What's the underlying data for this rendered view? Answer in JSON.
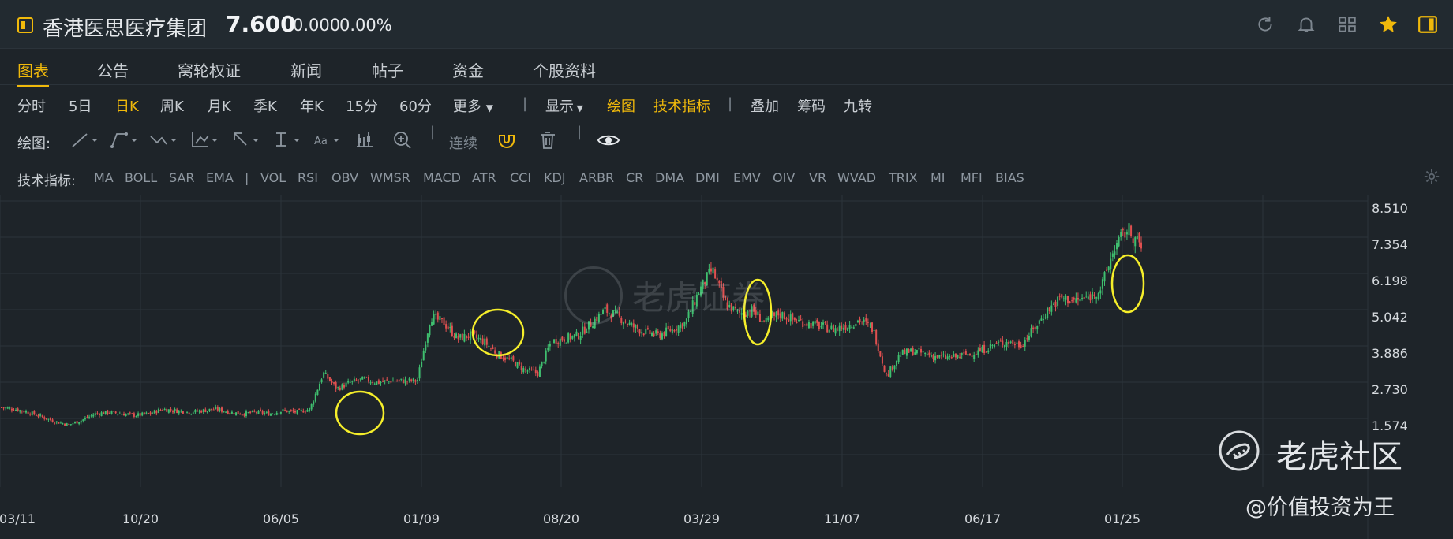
{
  "header": {
    "title": "香港医思医疗集团",
    "price": "7.600",
    "change": "0.000",
    "change_pct": "0.00%",
    "icons": [
      "refresh-icon",
      "bell-icon",
      "grid-icon",
      "star-icon",
      "panel-icon"
    ]
  },
  "tabs": [
    "图表",
    "公告",
    "窝轮权证",
    "新闻",
    "帖子",
    "资金",
    "个股资料"
  ],
  "active_tab": "图表",
  "periods": {
    "items": [
      "分时",
      "5日",
      "日K",
      "周K",
      "月K",
      "季K",
      "年K",
      "15分",
      "60分"
    ],
    "more": "更多",
    "display": "显示",
    "draw": "绘图",
    "tech": "技术指标",
    "overlay": "叠加",
    "chips": "筹码",
    "nine": "九转",
    "active": "日K"
  },
  "draw_row": {
    "label": "绘图:",
    "continuous": "连续"
  },
  "indicator_row": {
    "label": "技术指标:",
    "main": [
      "MA",
      "BOLL",
      "SAR",
      "EMA"
    ],
    "sub": [
      "VOL",
      "RSI",
      "OBV",
      "WMSR",
      "MACD",
      "ATR",
      "CCI",
      "KDJ",
      "ARBR",
      "CR",
      "DMA",
      "DMI",
      "EMV",
      "OIV",
      "VR",
      "WVAD",
      "TRIX",
      "MI",
      "MFI",
      "BIAS"
    ]
  },
  "watermark": {
    "center": "老虎证券",
    "corner": "老虎社区",
    "author": "@价值投资为王"
  },
  "chart_data": {
    "type": "candlestick",
    "y_ticks": [
      "8.510",
      "7.354",
      "6.198",
      "5.042",
      "3.886",
      "2.730",
      "1.574"
    ],
    "x_ticks": [
      "03/11",
      "10/20",
      "06/05",
      "01/09",
      "08/20",
      "03/29",
      "11/07",
      "06/17",
      "01/25"
    ],
    "ylim": [
      1.574,
      8.51
    ],
    "close_series": [
      2.5,
      2.45,
      2.35,
      2.2,
      2.05,
      1.95,
      2.1,
      2.3,
      2.35,
      2.3,
      2.25,
      2.3,
      2.45,
      2.4,
      2.35,
      2.4,
      2.45,
      2.35,
      2.3,
      2.35,
      2.3,
      2.4,
      2.35,
      2.45,
      3.6,
      3.1,
      3.3,
      3.4,
      3.3,
      3.35,
      3.35,
      3.35,
      5.4,
      5.2,
      4.7,
      4.8,
      4.6,
      4.2,
      4.0,
      3.7,
      3.6,
      4.6,
      4.7,
      4.8,
      5.2,
      5.6,
      5.4,
      5.1,
      4.9,
      4.8,
      5.0,
      5.2,
      6.2,
      6.9,
      5.8,
      5.5,
      5.6,
      5.2,
      5.5,
      5.3,
      5.2,
      5.1,
      5.0,
      5.1,
      5.3,
      5.0,
      3.5,
      4.2,
      4.3,
      4.2,
      4.1,
      4.1,
      4.2,
      4.3,
      4.5,
      4.6,
      4.5,
      5.0,
      5.6,
      6.0,
      5.9,
      6.0,
      6.3,
      7.6,
      8.2,
      7.6
    ],
    "highlight_circles": 4
  }
}
